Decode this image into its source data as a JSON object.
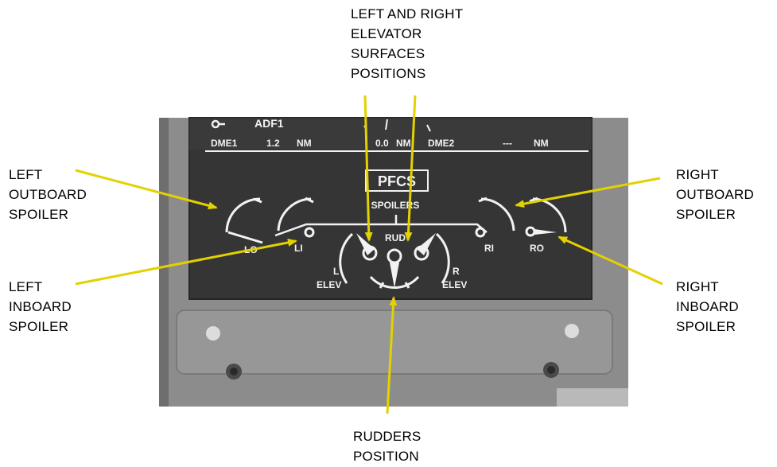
{
  "callouts": {
    "elevator": "LEFT AND RIGHT\nELEVATOR\nSURFACES\nPOSITIONS",
    "left_outboard": "LEFT\nOUTBOARD\nSPOILER",
    "left_inboard": "LEFT\nINBOARD\nSPOILER",
    "right_outboard": "RIGHT\nOUTBOARD\nSPOILER",
    "right_inboard": "RIGHT\nINBOARD\nSPOILER",
    "rudders": "RUDDERS\nPOSITION"
  },
  "display": {
    "adf": "ADF1",
    "dme1": "DME1",
    "dme1_value": "1.2",
    "dme1_unit": "NM",
    "center_value": "0.0",
    "center_unit": "NM",
    "dme2": "DME2",
    "dme2_value": "---",
    "dme2_unit": "NM",
    "title": "PFCS",
    "spoilers": "SPOILERS",
    "lo": "LO",
    "li": "LI",
    "ri": "RI",
    "ro": "RO",
    "rud": "RUD",
    "l": "L",
    "l_elev": "ELEV",
    "r": "R",
    "r_elev": "ELEV"
  },
  "colors": {
    "arrow": "#e3d100",
    "screen": "#353535",
    "bezel": "#8c8c8c",
    "symbol": "#f2f2f2"
  }
}
